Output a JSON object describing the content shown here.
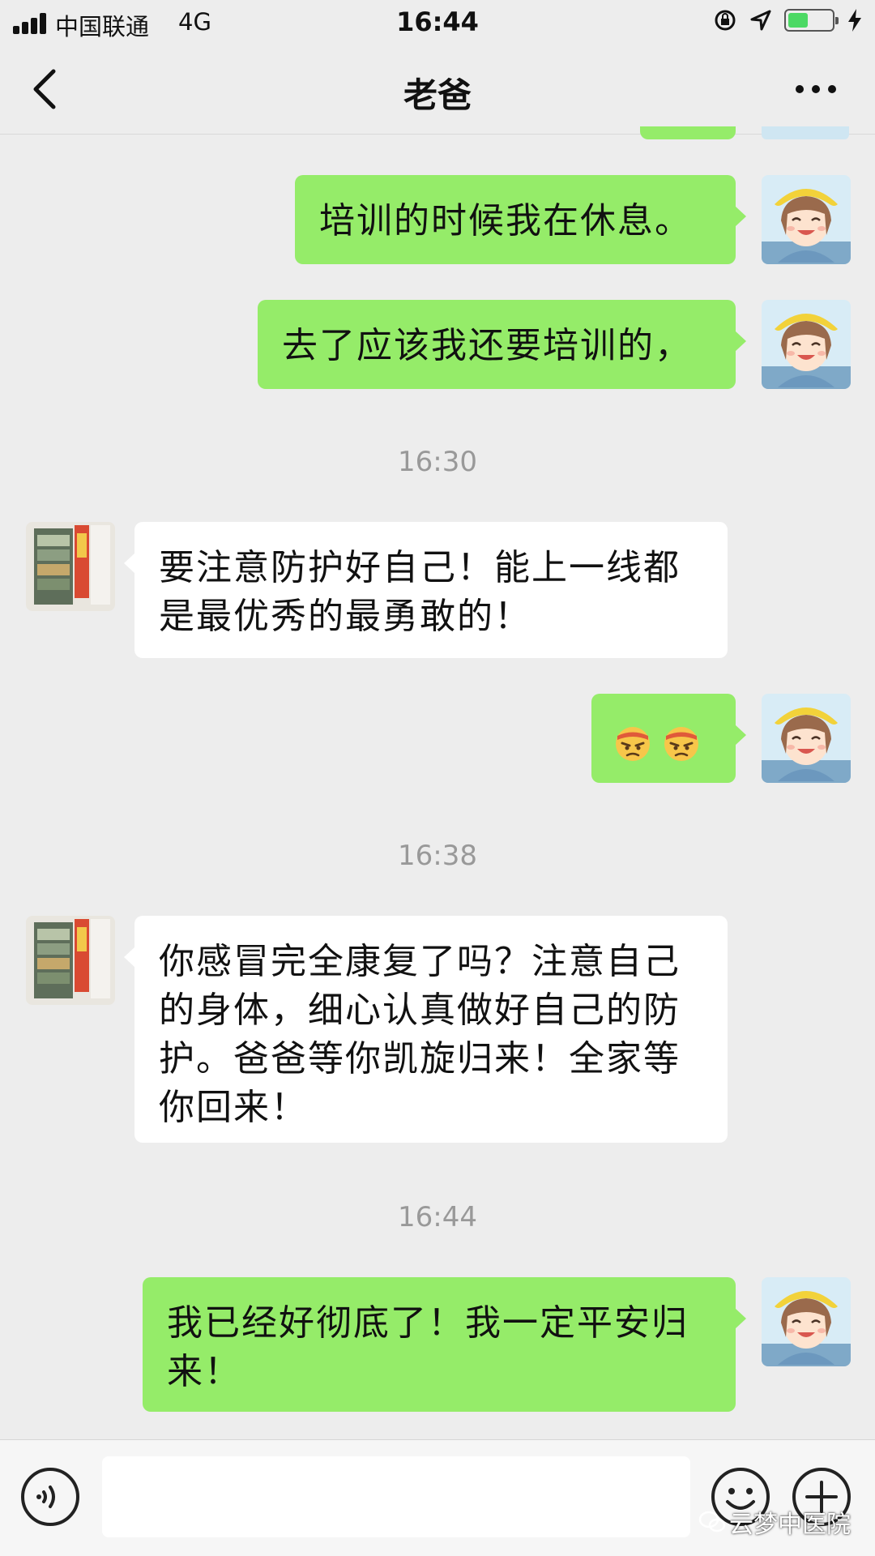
{
  "status_bar": {
    "carrier": "中国联通",
    "network": "4G",
    "time": "16:44",
    "battery_level": 0.45,
    "icons": [
      "signal-icon",
      "rotation-lock-icon",
      "location-icon",
      "battery-icon",
      "charging-bolt-icon"
    ]
  },
  "nav": {
    "title": "老爸",
    "back_icon": "chevron-left-icon",
    "more_icon": "more-dots-icon"
  },
  "messages": [
    {
      "sender": "me",
      "text": "培训的时候我在休息。"
    },
    {
      "sender": "me",
      "text": "去了应该我还要培训的，"
    },
    {
      "time": "16:30"
    },
    {
      "sender": "dad",
      "text": "要注意防护好自己！能上一线都是最优秀的最勇敢的！"
    },
    {
      "sender": "me",
      "emoji": [
        "angry-face-emoji",
        "angry-face-emoji"
      ]
    },
    {
      "time": "16:38"
    },
    {
      "sender": "dad",
      "text": "你感冒完全康复了吗？注意自己的身体，细心认真做好自己的防护。爸爸等你凯旋归来！全家等你回来！"
    },
    {
      "time": "16:44"
    },
    {
      "sender": "me",
      "text": "我已经好彻底了！我一定平安归来！"
    }
  ],
  "input_bar": {
    "voice_icon": "voice-icon",
    "emoji_icon": "emoji-icon",
    "add_icon": "plus-circle-icon"
  },
  "watermark": "云梦中医院",
  "colors": {
    "background": "#ededed",
    "my_bubble": "#95ec69",
    "their_bubble": "#ffffff",
    "timestamp": "#999999"
  }
}
